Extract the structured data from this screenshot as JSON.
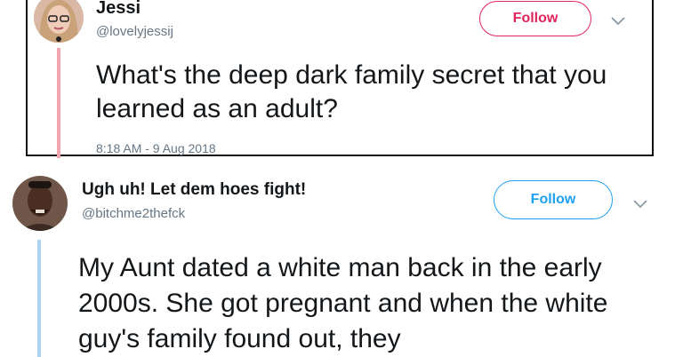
{
  "tweets": [
    {
      "name": "Jessi",
      "handle": "@lovelyjessij",
      "follow_label": "Follow",
      "text": "What's the deep dark family secret that you learned as an adult?",
      "timestamp": "8:18 AM - 9 Aug 2018",
      "accent_color": "#e0245e",
      "thread_color": "#f4a3b0",
      "icons": [
        "avatar",
        "chevron-down-icon"
      ]
    },
    {
      "name": "Ugh uh! Let dem hoes fight!",
      "handle": "@bitchme2thefck",
      "follow_label": "Follow",
      "text": "My Aunt dated a white man back in the early 2000s. She got pregnant and when the white guy's family found out, they",
      "accent_color": "#1da1f2",
      "thread_color": "#aed4f3",
      "icons": [
        "avatar",
        "chevron-down-icon"
      ]
    }
  ]
}
